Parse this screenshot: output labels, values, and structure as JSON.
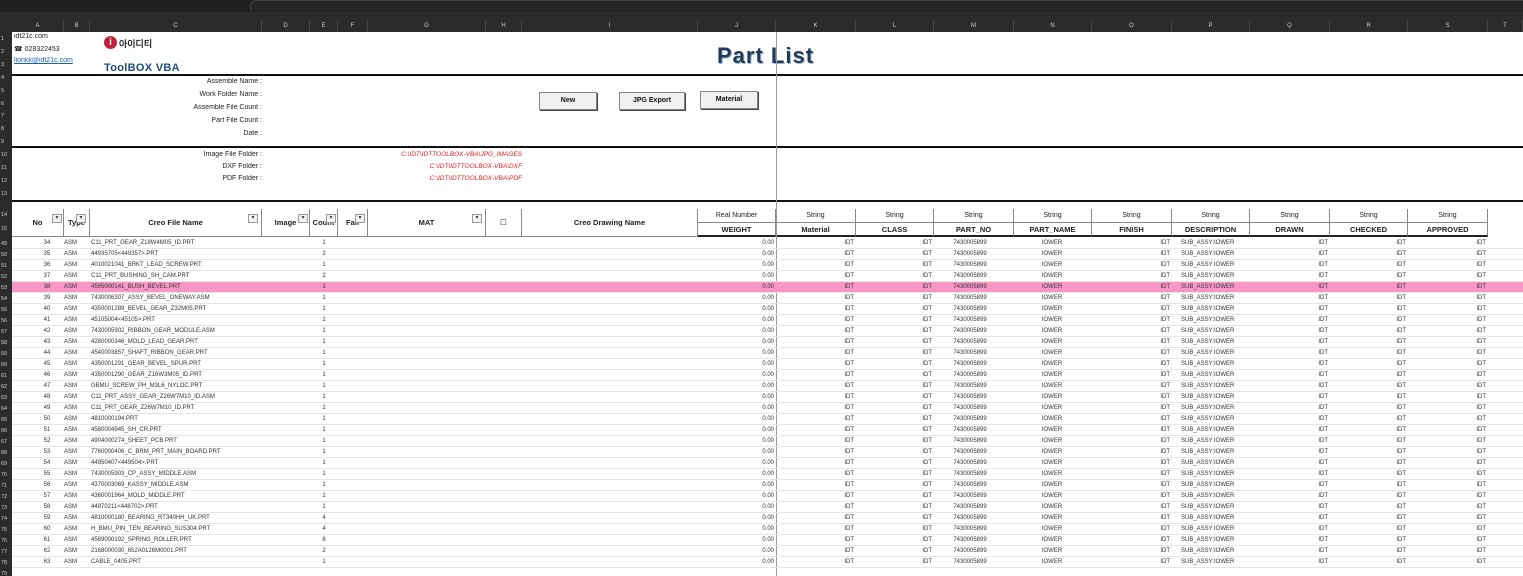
{
  "columns": [
    "A",
    "B",
    "C",
    "D",
    "E",
    "F",
    "G",
    "H",
    "I",
    "J",
    "K",
    "L",
    "M",
    "N",
    "O",
    "P",
    "Q",
    "R",
    "S",
    "T"
  ],
  "row_numbers": [
    "1",
    "2",
    "3",
    "4",
    "5",
    "6",
    "7",
    "8",
    "9",
    "10",
    "11",
    "12",
    "13",
    "14",
    "15",
    "49",
    "50",
    "51",
    "52",
    "53",
    "54",
    "55",
    "56",
    "57",
    "58",
    "59",
    "60",
    "61",
    "62",
    "63",
    "64",
    "65",
    "66",
    "67",
    "68",
    "69",
    "70",
    "71",
    "72",
    "73",
    "74",
    "75",
    "76",
    "77",
    "78",
    "79"
  ],
  "contact": {
    "site": "idt21c.com",
    "phone": "☎ 028322453",
    "email": "lionkk@idt21c.com"
  },
  "logo": {
    "mark": "i",
    "brand_kr": "아이디티",
    "product": "ToolBOX VBA"
  },
  "title": "Part List",
  "buttons": {
    "new": "New",
    "jpg": "JPG Export",
    "material": "Material"
  },
  "labels": {
    "assemble_name": "Assemble Name :",
    "work_folder": "Work Folder Name :",
    "assemble_count": "Assemble File Count :",
    "part_count": "Part File Count :",
    "date": "Date :",
    "image_folder": "Image File Folder :",
    "dxf_folder": "DXF Folder :",
    "pdf_folder": "PDF Folder :"
  },
  "folders": {
    "image": "C:\\IDT\\IDTTOOLBOX-VBA\\JPG_IMAGES",
    "dxf": "C:\\IDT\\IDTTOOLBOX-VBA\\DXF",
    "pdf": "C:\\IDT\\IDTTOOLBOX-VBA\\PDF"
  },
  "header": {
    "no": "No",
    "type": "Type",
    "file": "Creo File Name",
    "image": "Image",
    "count": "Count",
    "fail": "Fail",
    "mat": "MAT",
    "check": "☐",
    "drawing": "Creo Drawing Name",
    "attr_types": [
      "Real Number",
      "String",
      "String",
      "String",
      "String",
      "String",
      "String",
      "String",
      "String",
      "String"
    ],
    "attr_names": [
      "WEIGHT",
      "Material",
      "CLASS",
      "PART_NO",
      "PART_NAME",
      "FINISH",
      "DESCRIPTION",
      "DRAWN",
      "CHECKED",
      "APPROVED"
    ]
  },
  "rows": [
    {
      "no": "34",
      "type": "ASM",
      "file": "C11_PRT_GEAR_Z18W4M05_ID.PRT",
      "count": "1",
      "weight": "0.00",
      "material": "IDT",
      "class": "IDT",
      "part_no": "7430005899",
      "part_name": "IOWER",
      "finish": "IDT",
      "desc": "SUB_ASSY:IOWER",
      "drawn": "IDT",
      "checked": "IDT",
      "approved": "IDT",
      "hl": false
    },
    {
      "no": "35",
      "type": "ASM",
      "file": "44935705<449357>.PRT",
      "count": "2",
      "weight": "0.00",
      "material": "IDT",
      "class": "IDT",
      "part_no": "7430005899",
      "part_name": "IOWER",
      "finish": "IDT",
      "desc": "SUB_ASSY:IOWER",
      "drawn": "IDT",
      "checked": "IDT",
      "approved": "IDT",
      "hl": false
    },
    {
      "no": "36",
      "type": "ASM",
      "file": "4010021041_BRKT_LEAD_SCREW.PRT",
      "count": "1",
      "weight": "0.00",
      "material": "IDT",
      "class": "IDT",
      "part_no": "7430005899",
      "part_name": "IOWER",
      "finish": "IDT",
      "desc": "SUB_ASSY:IOWER",
      "drawn": "IDT",
      "checked": "IDT",
      "approved": "IDT",
      "hl": false
    },
    {
      "no": "37",
      "type": "ASM",
      "file": "C11_PRT_BUSHING_SH_CAM.PRT",
      "count": "2",
      "weight": "0.00",
      "material": "IDT",
      "class": "IDT",
      "part_no": "7430005899",
      "part_name": "IOWER",
      "finish": "IDT",
      "desc": "SUB_ASSY:IOWER",
      "drawn": "IDT",
      "checked": "IDT",
      "approved": "IDT",
      "hl": false
    },
    {
      "no": "38",
      "type": "ASM",
      "file": "4595000141_BUSH_BEVEL.PRT",
      "count": "1",
      "weight": "0.00",
      "material": "IDT",
      "class": "IDT",
      "part_no": "7430005899",
      "part_name": "IOWER",
      "finish": "IDT",
      "desc": "SUB_ASSY:IOWER",
      "drawn": "IDT",
      "checked": "IDT",
      "approved": "IDT",
      "hl": true
    },
    {
      "no": "39",
      "type": "ASM",
      "file": "7430006307_ASSY_BEVEL_ONEWAY.ASM",
      "count": "1",
      "weight": "0.00",
      "material": "IDT",
      "class": "IDT",
      "part_no": "7430005899",
      "part_name": "IOWER",
      "finish": "IDT",
      "desc": "SUB_ASSY:IOWER",
      "drawn": "IDT",
      "checked": "IDT",
      "approved": "IDT",
      "hl": false
    },
    {
      "no": "40",
      "type": "ASM",
      "file": "4350001289_BEVEL_GEAR_Z32M05.PRT",
      "count": "1",
      "weight": "0.00",
      "material": "IDT",
      "class": "IDT",
      "part_no": "7430005899",
      "part_name": "IOWER",
      "finish": "IDT",
      "desc": "SUB_ASSY:IOWER",
      "drawn": "IDT",
      "checked": "IDT",
      "approved": "IDT",
      "hl": false
    },
    {
      "no": "41",
      "type": "ASM",
      "file": "45105004<45105>.PRT",
      "count": "1",
      "weight": "0.00",
      "material": "IDT",
      "class": "IDT",
      "part_no": "7430005899",
      "part_name": "IOWER",
      "finish": "IDT",
      "desc": "SUB_ASSY:IOWER",
      "drawn": "IDT",
      "checked": "IDT",
      "approved": "IDT",
      "hl": false
    },
    {
      "no": "42",
      "type": "ASM",
      "file": "7430005902_RIBBON_GEAR_MODULE.ASM",
      "count": "1",
      "weight": "0.00",
      "material": "IDT",
      "class": "IDT",
      "part_no": "7430005899",
      "part_name": "IOWER",
      "finish": "IDT",
      "desc": "SUB_ASSY:IOWER",
      "drawn": "IDT",
      "checked": "IDT",
      "approved": "IDT",
      "hl": false
    },
    {
      "no": "43",
      "type": "ASM",
      "file": "4280000346_MOLD_LEAD_GEAR.PRT",
      "count": "1",
      "weight": "0.00",
      "material": "IDT",
      "class": "IDT",
      "part_no": "7430005899",
      "part_name": "IOWER",
      "finish": "IDT",
      "desc": "SUB_ASSY:IOWER",
      "drawn": "IDT",
      "checked": "IDT",
      "approved": "IDT",
      "hl": false
    },
    {
      "no": "44",
      "type": "ASM",
      "file": "4540003857_SHAFT_RIBBON_GEAR.PRT",
      "count": "1",
      "weight": "0.00",
      "material": "IDT",
      "class": "IDT",
      "part_no": "7430005899",
      "part_name": "IOWER",
      "finish": "IDT",
      "desc": "SUB_ASSY:IOWER",
      "drawn": "IDT",
      "checked": "IDT",
      "approved": "IDT",
      "hl": false
    },
    {
      "no": "45",
      "type": "ASM",
      "file": "4350001291_GEAR_BEVEL_SPUR.PRT",
      "count": "1",
      "weight": "0.00",
      "material": "IDT",
      "class": "IDT",
      "part_no": "7430005899",
      "part_name": "IOWER",
      "finish": "IDT",
      "desc": "SUB_ASSY:IOWER",
      "drawn": "IDT",
      "checked": "IDT",
      "approved": "IDT",
      "hl": false
    },
    {
      "no": "46",
      "type": "ASM",
      "file": "4350001290_GEAR_Z16W3M05_ID.PRT",
      "count": "1",
      "weight": "0.00",
      "material": "IDT",
      "class": "IDT",
      "part_no": "7430005899",
      "part_name": "IOWER",
      "finish": "IDT",
      "desc": "SUB_ASSY:IOWER",
      "drawn": "IDT",
      "checked": "IDT",
      "approved": "IDT",
      "hl": false
    },
    {
      "no": "47",
      "type": "ASM",
      "file": "GBMU_SCREW_PH_M3L6_NYLOC.PRT",
      "count": "1",
      "weight": "0.00",
      "material": "IDT",
      "class": "IDT",
      "part_no": "7430005899",
      "part_name": "IOWER",
      "finish": "IDT",
      "desc": "SUB_ASSY:IOWER",
      "drawn": "IDT",
      "checked": "IDT",
      "approved": "IDT",
      "hl": false
    },
    {
      "no": "48",
      "type": "ASM",
      "file": "C11_PRT_ASSY_GEAR_Z26W7M10_ID.ASM",
      "count": "1",
      "weight": "0.00",
      "material": "IDT",
      "class": "IDT",
      "part_no": "7430005899",
      "part_name": "IOWER",
      "finish": "IDT",
      "desc": "SUB_ASSY:IOWER",
      "drawn": "IDT",
      "checked": "IDT",
      "approved": "IDT",
      "hl": false
    },
    {
      "no": "49",
      "type": "ASM",
      "file": "C11_PRT_GEAR_Z26W7M10_ID.PRT",
      "count": "1",
      "weight": "0.00",
      "material": "IDT",
      "class": "IDT",
      "part_no": "7430005899",
      "part_name": "IOWER",
      "finish": "IDT",
      "desc": "SUB_ASSY:IOWER",
      "drawn": "IDT",
      "checked": "IDT",
      "approved": "IDT",
      "hl": false
    },
    {
      "no": "50",
      "type": "ASM",
      "file": "4810000194.PRT",
      "count": "1",
      "weight": "0.00",
      "material": "IDT",
      "class": "IDT",
      "part_no": "7430005899",
      "part_name": "IOWER",
      "finish": "IDT",
      "desc": "SUB_ASSY:IOWER",
      "drawn": "IDT",
      "checked": "IDT",
      "approved": "IDT",
      "hl": false
    },
    {
      "no": "51",
      "type": "ASM",
      "file": "4580004945_SH_CR.PRT",
      "count": "1",
      "weight": "0.00",
      "material": "IDT",
      "class": "IDT",
      "part_no": "7430005899",
      "part_name": "IOWER",
      "finish": "IDT",
      "desc": "SUB_ASSY:IOWER",
      "drawn": "IDT",
      "checked": "IDT",
      "approved": "IDT",
      "hl": false
    },
    {
      "no": "52",
      "type": "ASM",
      "file": "4904000274_SHEET_PCB.PRT",
      "count": "1",
      "weight": "0.00",
      "material": "IDT",
      "class": "IDT",
      "part_no": "7430005899",
      "part_name": "IOWER",
      "finish": "IDT",
      "desc": "SUB_ASSY:IOWER",
      "drawn": "IDT",
      "checked": "IDT",
      "approved": "IDT",
      "hl": false
    },
    {
      "no": "53",
      "type": "ASM",
      "file": "7760000406_C_BRM_PRT_MAIN_BOARD.PRT",
      "count": "1",
      "weight": "0.00",
      "material": "IDT",
      "class": "IDT",
      "part_no": "7430005899",
      "part_name": "IOWER",
      "finish": "IDT",
      "desc": "SUB_ASSY:IOWER",
      "drawn": "IDT",
      "checked": "IDT",
      "approved": "IDT",
      "hl": false
    },
    {
      "no": "54",
      "type": "ASM",
      "file": "44950407<449504>.PRT",
      "count": "1",
      "weight": "0.00",
      "material": "IDT",
      "class": "IDT",
      "part_no": "7430005899",
      "part_name": "IOWER",
      "finish": "IDT",
      "desc": "SUB_ASSY:IOWER",
      "drawn": "IDT",
      "checked": "IDT",
      "approved": "IDT",
      "hl": false
    },
    {
      "no": "55",
      "type": "ASM",
      "file": "7430005903_CP_ASSY_MIDDLE.ASM",
      "count": "1",
      "weight": "0.00",
      "material": "IDT",
      "class": "IDT",
      "part_no": "7430005899",
      "part_name": "IOWER",
      "finish": "IDT",
      "desc": "SUB_ASSY:IOWER",
      "drawn": "IDT",
      "checked": "IDT",
      "approved": "IDT",
      "hl": false
    },
    {
      "no": "56",
      "type": "ASM",
      "file": "4370003069_KASSY_MIDDLE.ASM",
      "count": "1",
      "weight": "0.00",
      "material": "IDT",
      "class": "IDT",
      "part_no": "7430005899",
      "part_name": "IOWER",
      "finish": "IDT",
      "desc": "SUB_ASSY:IOWER",
      "drawn": "IDT",
      "checked": "IDT",
      "approved": "IDT",
      "hl": false
    },
    {
      "no": "57",
      "type": "ASM",
      "file": "4360001964_MOLD_MIDDLE.PRT",
      "count": "1",
      "weight": "0.00",
      "material": "IDT",
      "class": "IDT",
      "part_no": "7430005899",
      "part_name": "IOWER",
      "finish": "IDT",
      "desc": "SUB_ASSY:IOWER",
      "drawn": "IDT",
      "checked": "IDT",
      "approved": "IDT",
      "hl": false
    },
    {
      "no": "58",
      "type": "ASM",
      "file": "44870211<448702>.PRT",
      "count": "1",
      "weight": "0.00",
      "material": "IDT",
      "class": "IDT",
      "part_no": "7430005899",
      "part_name": "IOWER",
      "finish": "IDT",
      "desc": "SUB_ASSY:IOWER",
      "drawn": "IDT",
      "checked": "IDT",
      "approved": "IDT",
      "hl": false
    },
    {
      "no": "59",
      "type": "ASM",
      "file": "4810000180_BEARING_RT340HH_UK.PRT",
      "count": "4",
      "weight": "0.00",
      "material": "IDT",
      "class": "IDT",
      "part_no": "7430005899",
      "part_name": "IOWER",
      "finish": "IDT",
      "desc": "SUB_ASSY:IOWER",
      "drawn": "IDT",
      "checked": "IDT",
      "approved": "IDT",
      "hl": false
    },
    {
      "no": "60",
      "type": "ASM",
      "file": "H_BMU_PIN_TEN_BEARING_SUS304.PRT",
      "count": "4",
      "weight": "0.00",
      "material": "IDT",
      "class": "IDT",
      "part_no": "7430005899",
      "part_name": "IOWER",
      "finish": "IDT",
      "desc": "SUB_ASSY:IOWER",
      "drawn": "IDT",
      "checked": "IDT",
      "approved": "IDT",
      "hl": false
    },
    {
      "no": "61",
      "type": "ASM",
      "file": "4589000192_SPRING_ROLLER.PRT",
      "count": "8",
      "weight": "0.00",
      "material": "IDT",
      "class": "IDT",
      "part_no": "7430005899",
      "part_name": "IOWER",
      "finish": "IDT",
      "desc": "SUB_ASSY:IOWER",
      "drawn": "IDT",
      "checked": "IDT",
      "approved": "IDT",
      "hl": false
    },
    {
      "no": "62",
      "type": "ASM",
      "file": "2168000030_652A0126M0001.PRT",
      "count": "2",
      "weight": "0.00",
      "material": "IDT",
      "class": "IDT",
      "part_no": "7430005899",
      "part_name": "IOWER",
      "finish": "IDT",
      "desc": "SUB_ASSY:IOWER",
      "drawn": "IDT",
      "checked": "IDT",
      "approved": "IDT",
      "hl": false
    },
    {
      "no": "63",
      "type": "ASM",
      "file": "CABLE_0405.PRT",
      "count": "1",
      "weight": "0.00",
      "material": "IDT",
      "class": "IDT",
      "part_no": "7430005899",
      "part_name": "IOWER",
      "finish": "IDT",
      "desc": "SUB_ASSY:IOWER",
      "drawn": "IDT",
      "checked": "IDT",
      "approved": "IDT",
      "hl": false
    }
  ]
}
